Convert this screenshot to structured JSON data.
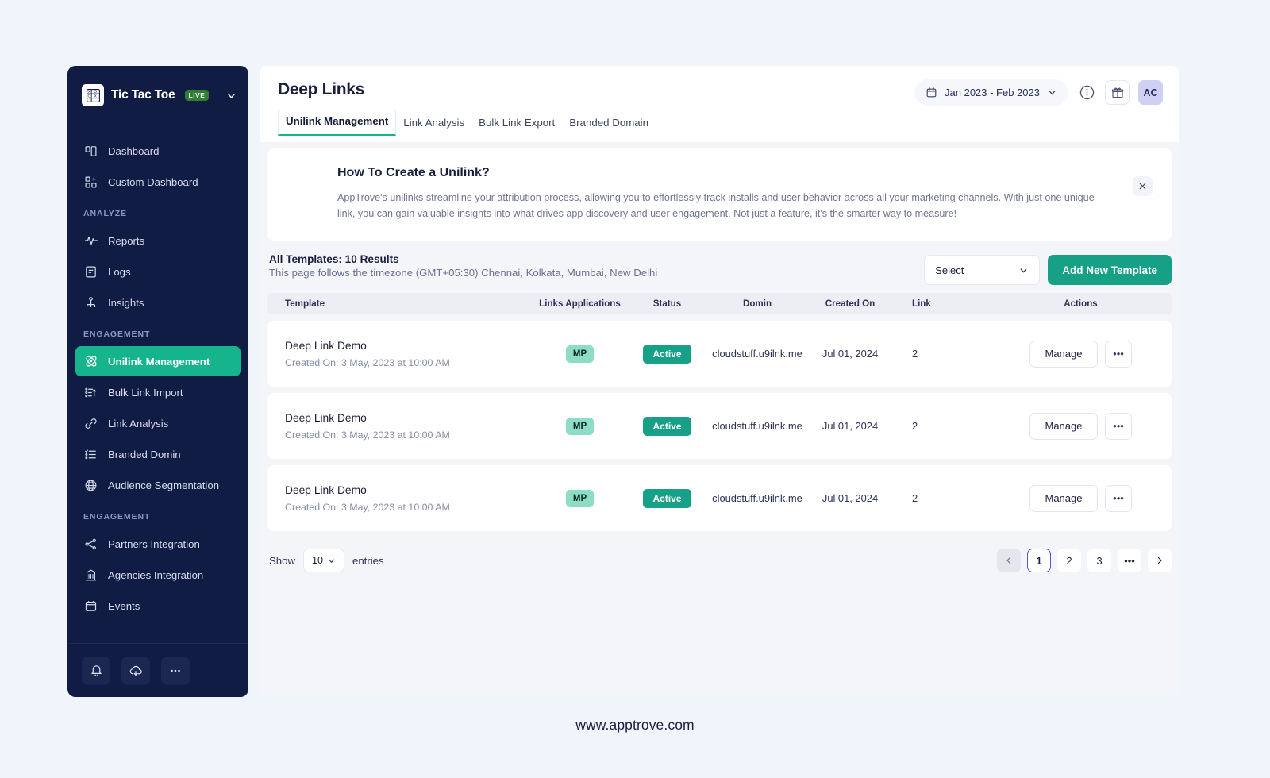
{
  "sidebar": {
    "brand": {
      "name": "Tic Tac Toe",
      "badge": "LIVE",
      "logo_icon": "tic-tac-toe-logo-icon",
      "caret_icon": "chevron-down-icon"
    },
    "groups": [
      {
        "label": "",
        "items": [
          {
            "label": "Dashboard",
            "icon": "dashboard-icon",
            "active": false
          },
          {
            "label": "Custom Dashboard",
            "icon": "custom-dashboard-icon",
            "active": false
          }
        ]
      },
      {
        "label": "ANALYZE",
        "items": [
          {
            "label": "Reports",
            "icon": "pulse-icon",
            "active": false
          },
          {
            "label": "Logs",
            "icon": "logs-icon",
            "active": false
          },
          {
            "label": "Insights",
            "icon": "insights-icon",
            "active": false
          }
        ]
      },
      {
        "label": "ENGAGEMENT",
        "items": [
          {
            "label": "Unilink Management",
            "icon": "unilink-icon",
            "active": true
          },
          {
            "label": "Bulk Link Import",
            "icon": "bulk-import-icon",
            "active": false
          },
          {
            "label": "Link Analysis",
            "icon": "link-icon",
            "active": false
          },
          {
            "label": "Branded Domin",
            "icon": "checklist-icon",
            "active": false
          },
          {
            "label": "Audience Segmentation",
            "icon": "globe-icon",
            "active": false
          }
        ]
      },
      {
        "label": "ENGAGEMENT",
        "items": [
          {
            "label": "Partners Integration",
            "icon": "share-nodes-icon",
            "active": false
          },
          {
            "label": "Agencies Integration",
            "icon": "agency-building-icon",
            "active": false
          },
          {
            "label": "Events",
            "icon": "calendar-events-icon",
            "active": false
          }
        ]
      }
    ],
    "footer_buttons": [
      {
        "icon": "bell-icon",
        "label": ""
      },
      {
        "icon": "cloud-download-icon",
        "label": ""
      },
      {
        "icon": "more-horizontal-icon",
        "label": ""
      }
    ]
  },
  "header": {
    "title": "Deep Links",
    "tabs": [
      {
        "label": "Unilink Management",
        "active": true
      },
      {
        "label": "Link Analysis",
        "active": false
      },
      {
        "label": "Bulk Link Export",
        "active": false
      },
      {
        "label": "Branded Domain",
        "active": false
      }
    ],
    "date_range": {
      "value": "Jan 2023 - Feb 2023",
      "calendar_icon": "calendar-icon",
      "caret_icon": "chevron-down-icon"
    },
    "info_icon": "info-circle-icon",
    "gift_icon": "gift-icon",
    "avatar_initials": "AC"
  },
  "banner": {
    "title": "How To Create a Unilink?",
    "body": "AppTrove's unilinks streamline your attribution process, allowing you to effortlessly track installs and user behavior across all your marketing channels. With just one unique link, you can gain valuable insights into what drives app discovery and user engagement. Not just a feature, it's the smarter way to measure!",
    "close_icon": "close-icon"
  },
  "toolbar": {
    "results_title": "All Templates: 10 Results",
    "timezone_note": "This page follows the timezone (GMT+05:30) Chennai, Kolkata, Mumbai, New Delhi",
    "select_label": "Select",
    "select_caret_icon": "chevron-down-icon",
    "add_button": "Add New Template"
  },
  "table": {
    "columns": [
      "Template",
      "Links Applications",
      "Status",
      "Domin",
      "Created On",
      "Link",
      "Actions"
    ],
    "rows": [
      {
        "template": "Deep Link Demo",
        "created_sub": "Created On: 3 May, 2023 at 10:00 AM",
        "links_applications": "MP",
        "status": "Active",
        "domain": "cloudstuff.u9ilnk.me",
        "created_on": "Jul 01, 2024",
        "link": "2",
        "manage_label": "Manage",
        "more_label": "•••"
      },
      {
        "template": "Deep Link Demo",
        "created_sub": "Created On: 3 May, 2023 at 10:00 AM",
        "links_applications": "MP",
        "status": "Active",
        "domain": "cloudstuff.u9ilnk.me",
        "created_on": "Jul 01, 2024",
        "link": "2",
        "manage_label": "Manage",
        "more_label": "•••"
      },
      {
        "template": "Deep Link Demo",
        "created_sub": "Created On: 3 May, 2023 at 10:00 AM",
        "links_applications": "MP",
        "status": "Active",
        "domain": "cloudstuff.u9ilnk.me",
        "created_on": "Jul 01, 2024",
        "link": "2",
        "manage_label": "Manage",
        "more_label": "•••"
      }
    ]
  },
  "pagination": {
    "show_label": "Show",
    "page_size": "10",
    "entries_label": "entries",
    "prev_icon": "chevron-left-icon",
    "next_icon": "chevron-right-icon",
    "pages": [
      "1",
      "2",
      "3",
      "•••"
    ],
    "current_page": "1"
  },
  "footer": {
    "url": "www.apptrove.com"
  },
  "colors": {
    "sidebar_bg": "#111c44",
    "accent_green": "#16a085",
    "active_nav": "#16b48c",
    "page_bg": "#f0f4fb",
    "pager_active_border": "#5b4ef0",
    "avatar_bg": "#cfd0f3",
    "chip_mp_bg": "#8ddcc6"
  }
}
